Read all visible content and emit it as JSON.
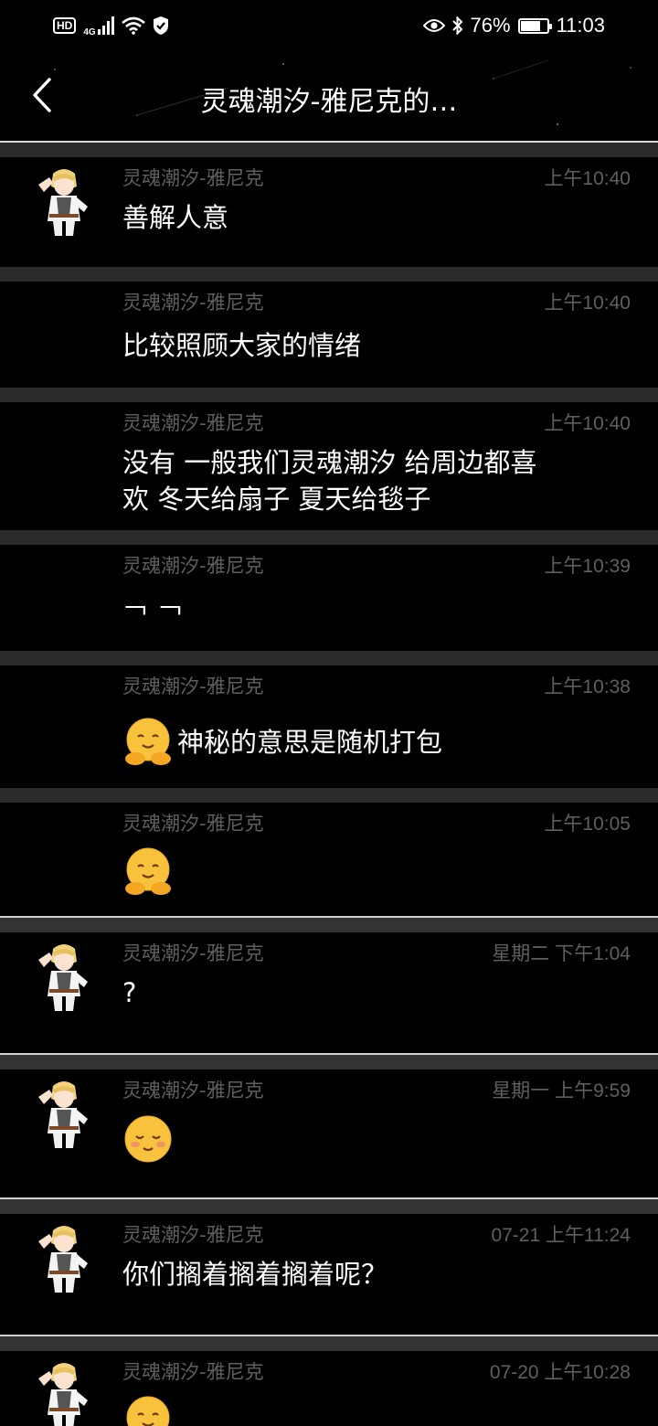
{
  "status_bar": {
    "network_badge": "HD",
    "network_type": "4G",
    "battery_percent": "76%",
    "battery_level": 0.76,
    "time": "11:03"
  },
  "header": {
    "title": "灵魂潮汐-雅尼克的…"
  },
  "messages": [
    {
      "sender": "灵魂潮汐-雅尼克",
      "time": "上午10:40",
      "text": "善解人意"
    },
    {
      "sender": "灵魂潮汐-雅尼克",
      "time": "上午10:40",
      "text": "比较照顾大家的情绪"
    },
    {
      "sender": "灵魂潮汐-雅尼克",
      "time": "上午10:40",
      "text_line1": "没有 一般我们灵魂潮汐 给周边都喜",
      "text_line2": "欢 冬天给扇子 夏天给毯子"
    },
    {
      "sender": "灵魂潮汐-雅尼克",
      "time": "上午10:39",
      "text": "￢ ￢"
    },
    {
      "sender": "灵魂潮汐-雅尼克",
      "time": "上午10:38",
      "text": "神秘的意思是随机打包",
      "emoji": "hugging-face-emoji"
    },
    {
      "sender": "灵魂潮汐-雅尼克",
      "time": "上午10:05",
      "emoji": "hugging-face-emoji"
    },
    {
      "sender": "灵魂潮汐-雅尼克",
      "time": "星期二 下午1:04",
      "text": "?"
    },
    {
      "sender": "灵魂潮汐-雅尼克",
      "time": "星期一 上午9:59",
      "emoji": "relieved-face-emoji"
    },
    {
      "sender": "灵魂潮汐-雅尼克",
      "time": "07-21 上午11:24",
      "text": "你们搁着搁着搁着呢？"
    },
    {
      "sender": "灵魂潮汐-雅尼克",
      "time": "07-20 上午10:28",
      "emoji": "hugging-face-emoji"
    }
  ],
  "colors": {
    "background": "#000000",
    "meta_text": "#5f5f5f",
    "separator": "#2b2b2b",
    "emoji_yellow": "#f9c23c"
  }
}
